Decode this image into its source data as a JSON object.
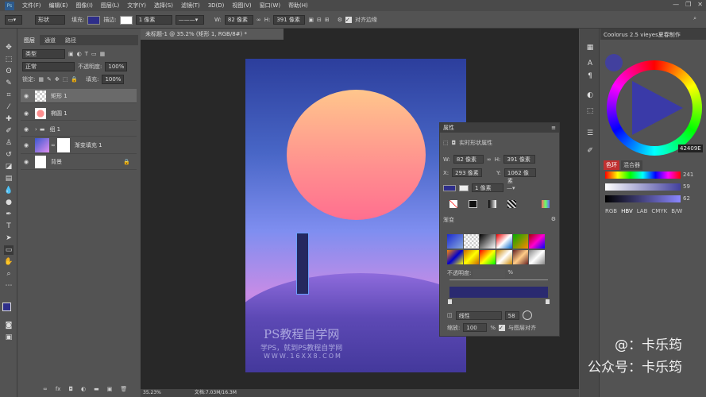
{
  "menu": {
    "items": [
      "文件(F)",
      "编辑(E)",
      "图像(I)",
      "图层(L)",
      "文字(Y)",
      "选择(S)",
      "滤镜(T)",
      "3D(D)",
      "视图(V)",
      "窗口(W)",
      "帮助(H)"
    ]
  },
  "options": {
    "mode": "形状",
    "fill_label": "填充:",
    "stroke_label": "描边:",
    "stroke_size": "1 像素",
    "w_label": "W:",
    "w_value": "82 像素",
    "h_label": "H:",
    "h_value": "391 像素",
    "align_edges": "对齐边缘"
  },
  "layers_panel": {
    "tabs": [
      "图层",
      "通道",
      "路径"
    ],
    "kind": "类型",
    "blend": "正常",
    "opacity_label": "不透明度:",
    "opacity": "100%",
    "lock_label": "锁定:",
    "fill_label": "填充:",
    "fill": "100%",
    "layers": [
      {
        "name": "矩形 1"
      },
      {
        "name": "椭圆 1"
      },
      {
        "name": "组 1"
      },
      {
        "name": "渐变填充 1"
      },
      {
        "name": "背景"
      }
    ]
  },
  "document": {
    "tab_title": "未标题-1 @ 35.2% (矩形 1, RGB/8#) *",
    "zoom": "35.23%",
    "doc_info": "文档:7.03M/16.3M"
  },
  "watermark": {
    "title": "PS教程自学网",
    "line2": "学PS，就到PS教程自学网",
    "line3": "WWW.16XX8.COM"
  },
  "properties": {
    "title": "属性",
    "subtitle": "实时形状属性",
    "w_label": "W:",
    "w": "82 像素",
    "h_label": "H:",
    "h": "391 像素",
    "x_label": "X:",
    "x": "293 像素",
    "y_label": "Y:",
    "y": "1062 像素",
    "stroke": "1 像素",
    "gradient_label": "渐变",
    "opacity_label": "不透明度:",
    "opacity_unit": "%",
    "style": "线性",
    "angle": "58",
    "scale_label": "缩放:",
    "scale": "100",
    "scale_unit": "%",
    "align_layer": "与图层对齐"
  },
  "coolorus": {
    "title": "Coolorus 2.5 vieyes夏春制作",
    "hex": "42409E",
    "tabs": [
      "色环",
      "混合器"
    ],
    "r": "241",
    "g": "59",
    "b": "62",
    "modes": [
      "RGB",
      "HBV",
      "LAB",
      "CMYK",
      "B/W"
    ]
  },
  "brand": {
    "line1": "@：卡乐筠",
    "line2": "公众号：卡乐筠"
  },
  "colors": {
    "foreground": "#2e2e8a",
    "shape": "#25285f"
  }
}
